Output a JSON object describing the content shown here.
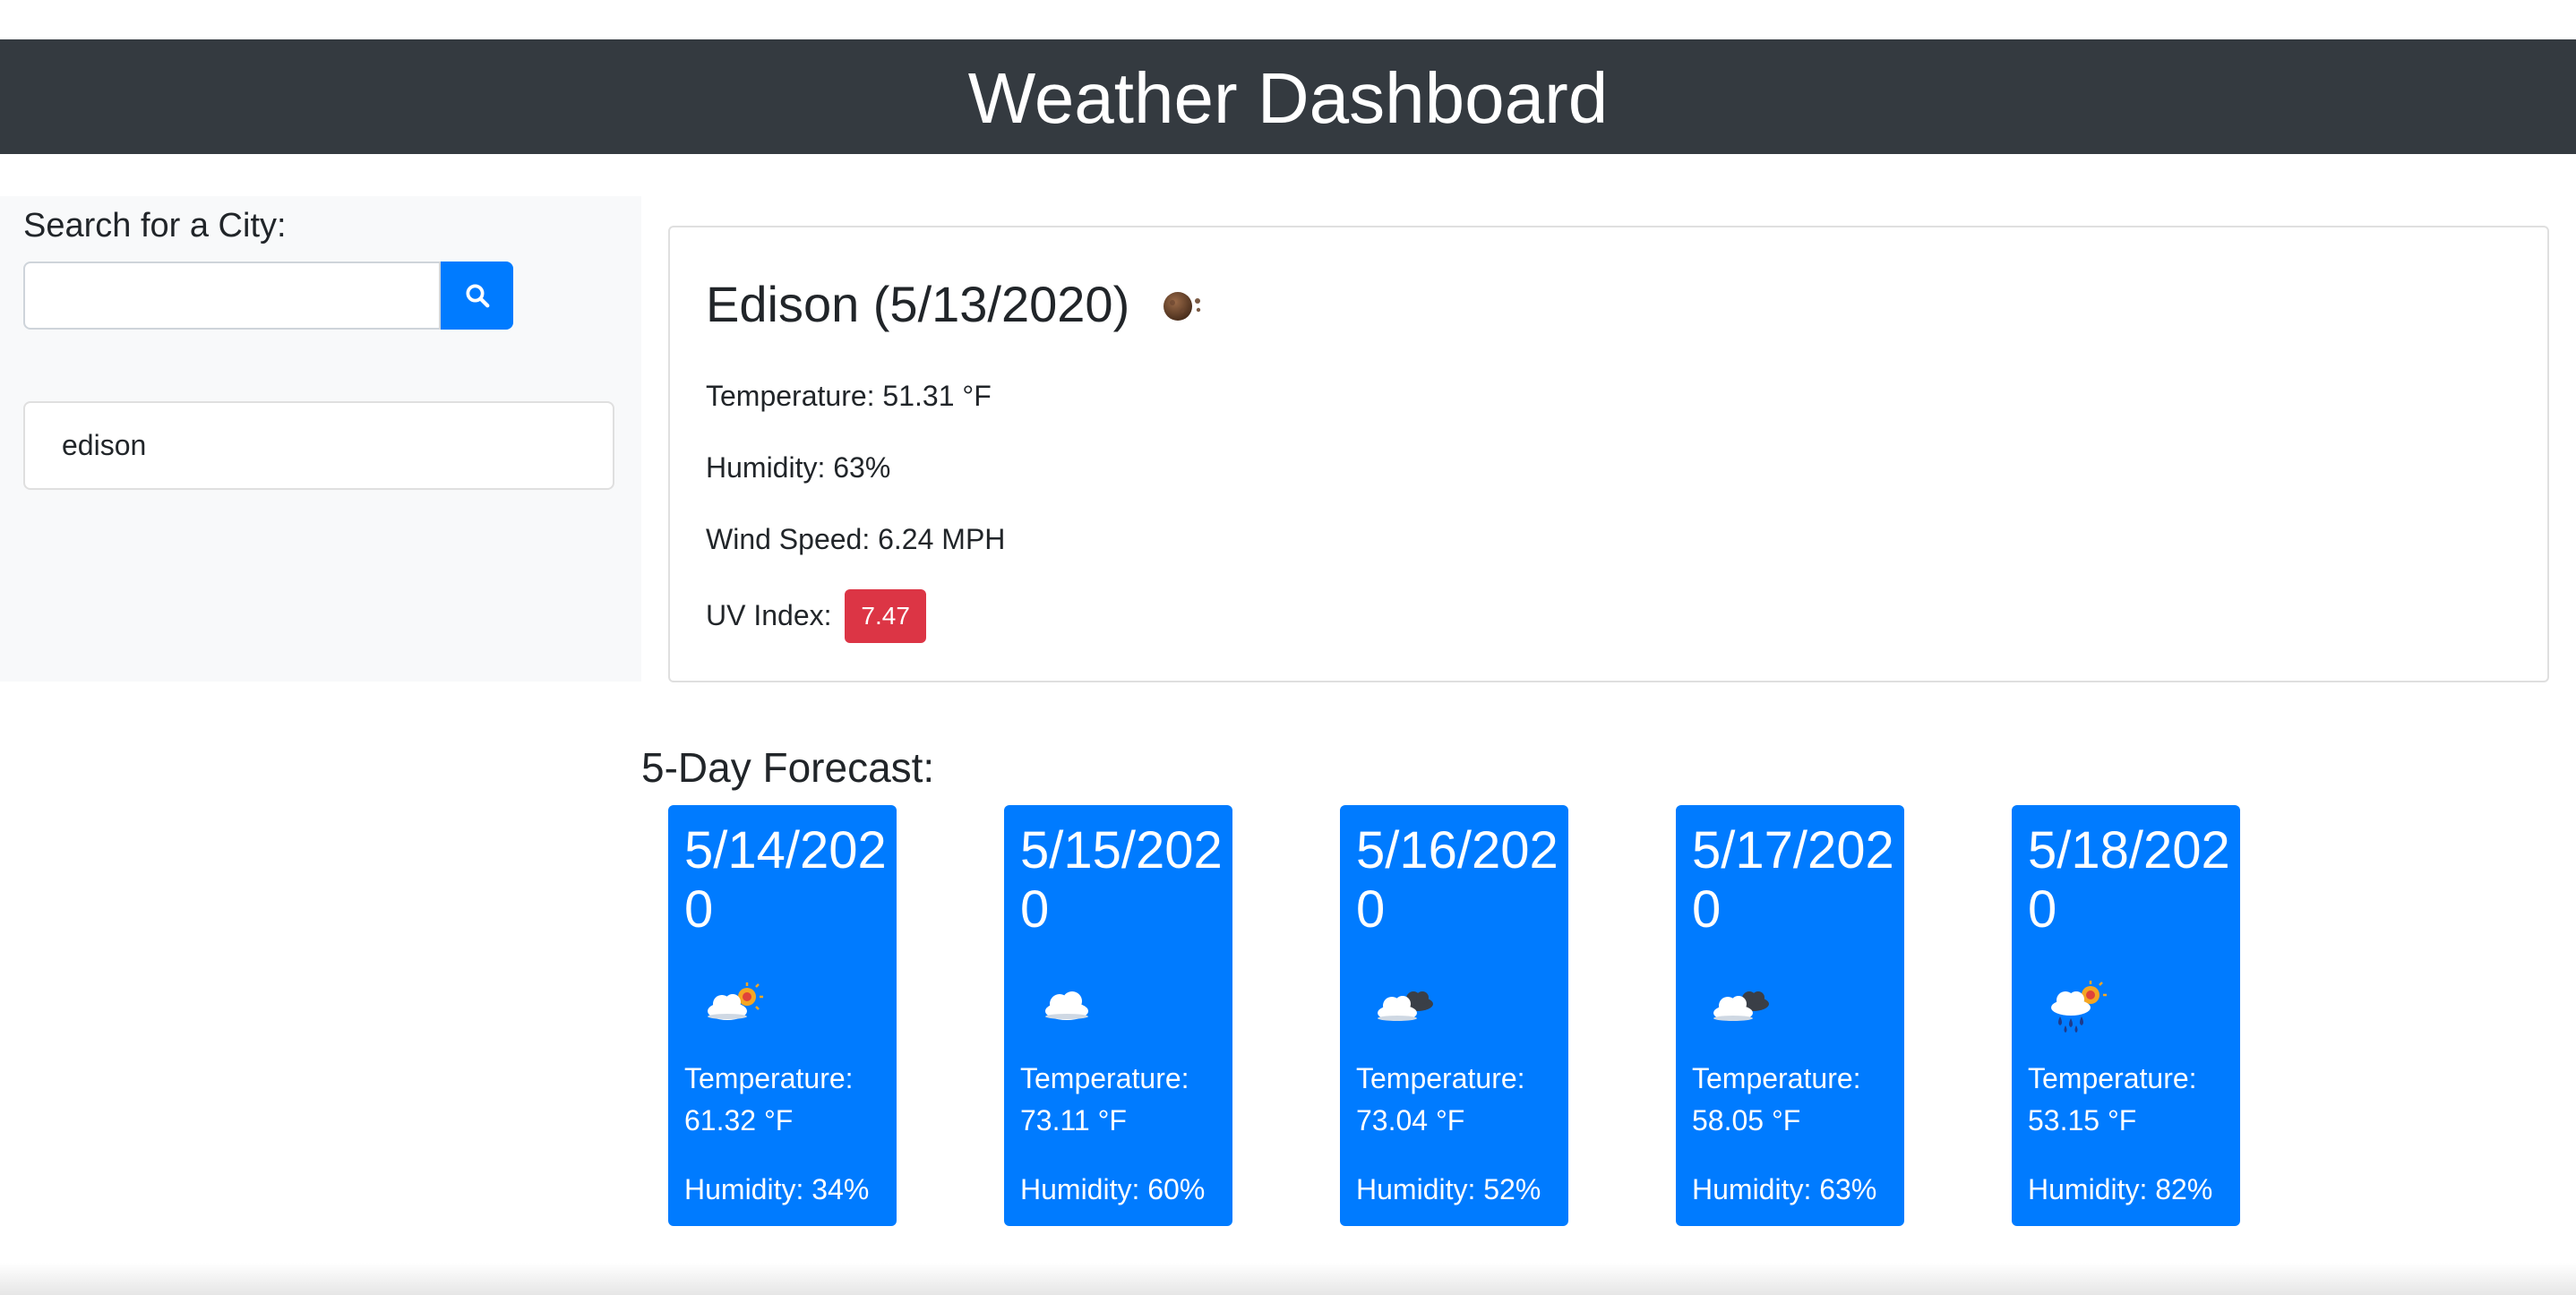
{
  "header": {
    "title": "Weather Dashboard"
  },
  "sidebar": {
    "search_label": "Search for a City:",
    "search_placeholder": "",
    "search_value": "",
    "search_button_icon": "search-icon",
    "history": [
      {
        "label": "edison"
      }
    ]
  },
  "current": {
    "title": "Edison (5/13/2020)",
    "icon": "moon-clear-icon",
    "temperature": "Temperature: 51.31 °F",
    "humidity": "Humidity: 63%",
    "wind": "Wind Speed: 6.24 MPH",
    "uv_label": "UV Index:",
    "uv_value": "7.47",
    "uv_color": "#dc3545"
  },
  "forecast": {
    "title": "5-Day Forecast:",
    "card_color": "#007bff",
    "days": [
      {
        "date": "5/14/2020",
        "icon": "partly-cloudy-day-icon",
        "temp_label": "Temperature:",
        "temp": "61.32 °F",
        "humidity": "Humidity: 34%"
      },
      {
        "date": "5/15/2020",
        "icon": "cloud-icon",
        "temp_label": "Temperature:",
        "temp": "73.11 °F",
        "humidity": "Humidity: 60%"
      },
      {
        "date": "5/16/2020",
        "icon": "broken-clouds-icon",
        "temp_label": "Temperature:",
        "temp": "73.04 °F",
        "humidity": "Humidity: 52%"
      },
      {
        "date": "5/17/2020",
        "icon": "broken-clouds-icon",
        "temp_label": "Temperature:",
        "temp": "58.05 °F",
        "humidity": "Humidity: 63%"
      },
      {
        "date": "5/18/2020",
        "icon": "rain-sun-icon",
        "temp_label": "Temperature:",
        "temp": "53.15 °F",
        "humidity": "Humidity: 82%"
      }
    ]
  }
}
